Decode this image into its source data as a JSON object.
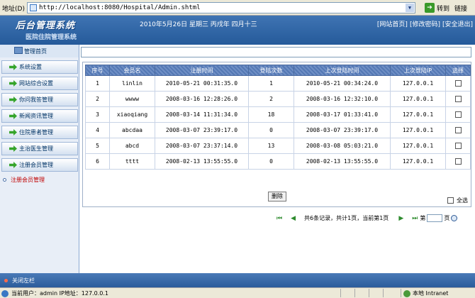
{
  "browser": {
    "address_label": "地址(D)",
    "url": "http://localhost:8080/Hospital/Admin.shtml",
    "go_label": "转到",
    "links_label": "链接"
  },
  "header": {
    "logo": "后台管理系统",
    "subtitle": "医院住院管理系统",
    "date_line": "2010年5月26日 星期三 丙戌年 四月十三",
    "links": [
      "[网站首页]",
      "[修改密码]",
      "[安全退出]"
    ]
  },
  "sidebar": {
    "title": "管理首页",
    "items": [
      "系统设置",
      "网站综合设置",
      "你问我答管理",
      "新闻资讯管理",
      "住院患者管理",
      "主治医生管理",
      "注册会员管理"
    ],
    "sub_item": "注册会员管理"
  },
  "table": {
    "columns": [
      "序号",
      "会员名",
      "注册时间",
      "登陆次数",
      "上次登陆时间",
      "上次登陆IP",
      "选择"
    ],
    "rows": [
      [
        "1",
        "linlin",
        "2010-05-21 00:31:35.0",
        "1",
        "2010-05-21 00:34:24.0",
        "127.0.0.1"
      ],
      [
        "2",
        "wwww",
        "2008-03-16 12:28:26.0",
        "2",
        "2008-03-16 12:32:10.0",
        "127.0.0.1"
      ],
      [
        "3",
        "xiaoqiang",
        "2008-03-14 11:31:34.0",
        "18",
        "2008-03-17 01:33:41.0",
        "127.0.0.1"
      ],
      [
        "4",
        "abcdaa",
        "2008-03-07 23:39:17.0",
        "0",
        "2008-03-07 23:39:17.0",
        "127.0.0.1"
      ],
      [
        "5",
        "abcd",
        "2008-03-07 23:37:14.0",
        "13",
        "2008-03-08 05:03:21.0",
        "127.0.0.1"
      ],
      [
        "6",
        "tttt",
        "2008-02-13 13:55:55.0",
        "0",
        "2008-02-13 13:55:55.0",
        "127.0.0.1"
      ]
    ],
    "select_all": "全选"
  },
  "pager": {
    "first": "⏮",
    "prev": "◀",
    "info": "共6条记录，共计1页，当前第1页",
    "next": "▶",
    "last": "⏭",
    "goto_prefix": "第",
    "goto_suffix": "页"
  },
  "delete_label": "删除",
  "footer": {
    "close_left": "关闭左栏"
  },
  "status": {
    "user": "当前用户：admin  IP地址：127.0.0.1",
    "zone": "本地 Intranet"
  }
}
